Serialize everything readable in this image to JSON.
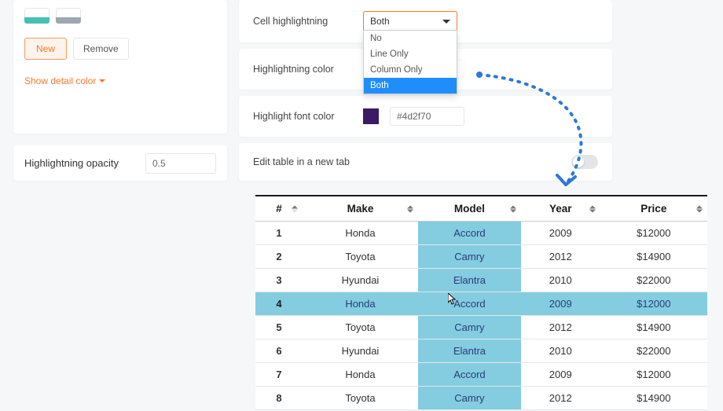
{
  "color_panel": {
    "new_btn": "New",
    "remove_btn": "Remove",
    "show_detail": "Show detail color"
  },
  "opacity": {
    "label": "Highlightning opacity",
    "value": "0.5"
  },
  "config": {
    "cell_highlight_label": "Cell highlightning",
    "cell_highlight_value": "Both",
    "dropdown": [
      "No",
      "Line Only",
      "Column Only",
      "Both"
    ],
    "highlight_color_label": "Highlightning color",
    "highlight_color_hex": "#2ca8cc",
    "highlight_font_label": "Highlight font color",
    "highlight_font_hex": "#4d2f70",
    "edit_tab_label": "Edit table in a new tab"
  },
  "table": {
    "headers": [
      "#",
      "Make",
      "Model",
      "Year",
      "Price"
    ],
    "rows": [
      {
        "idx": "1",
        "make": "Honda",
        "model": "Accord",
        "year": "2009",
        "price": "$12000"
      },
      {
        "idx": "2",
        "make": "Toyota",
        "model": "Camry",
        "year": "2012",
        "price": "$14900"
      },
      {
        "idx": "3",
        "make": "Hyundai",
        "model": "Elantra",
        "year": "2010",
        "price": "$22000"
      },
      {
        "idx": "4",
        "make": "Honda",
        "model": "Accord",
        "year": "2009",
        "price": "$12000"
      },
      {
        "idx": "5",
        "make": "Toyota",
        "model": "Camry",
        "year": "2012",
        "price": "$14900"
      },
      {
        "idx": "6",
        "make": "Hyundai",
        "model": "Elantra",
        "year": "2010",
        "price": "$22000"
      },
      {
        "idx": "7",
        "make": "Honda",
        "model": "Accord",
        "year": "2009",
        "price": "$12000"
      },
      {
        "idx": "8",
        "make": "Toyota",
        "model": "Camry",
        "year": "2012",
        "price": "$14900"
      }
    ],
    "highlighted_row": 3,
    "highlighted_col": 2
  },
  "colors": {
    "highlight": "#84cde0",
    "font_swatch": "#3c1a66"
  }
}
